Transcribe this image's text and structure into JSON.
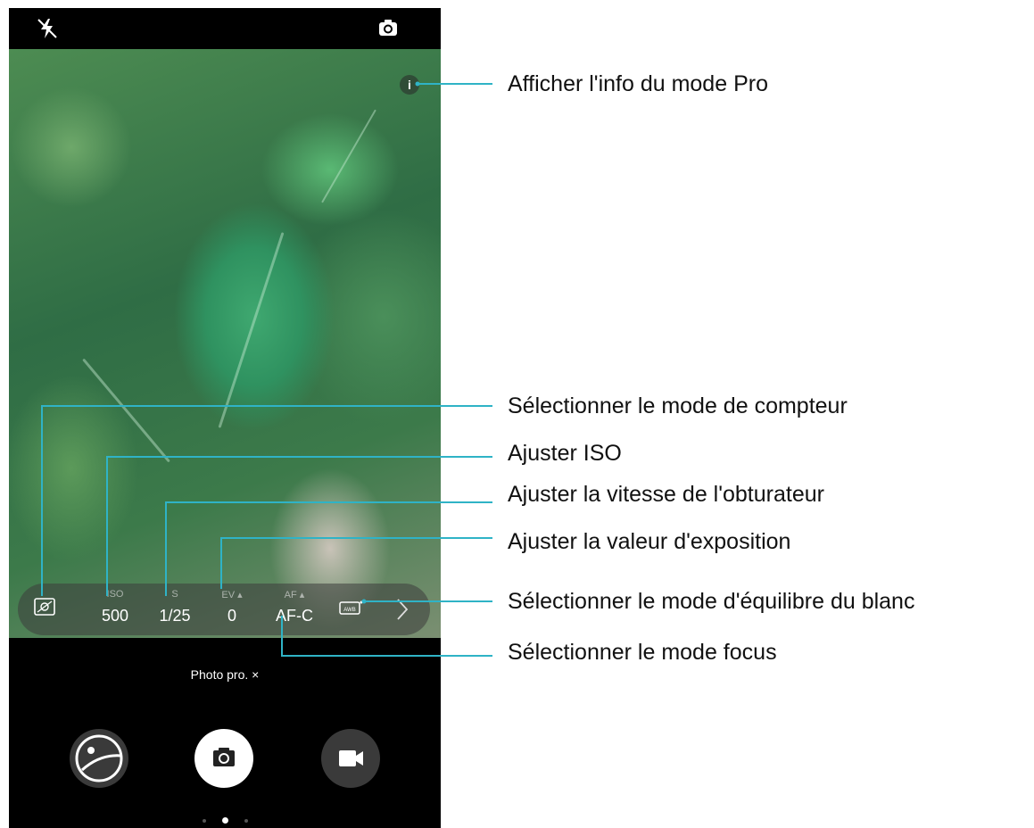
{
  "camera": {
    "mode_label": "Photo pro. ×",
    "info_icon_text": "i",
    "params": [
      {
        "name": "meter",
        "label": "",
        "value": "",
        "icon": "metering-icon"
      },
      {
        "name": "iso",
        "label": "ISO",
        "value": "500"
      },
      {
        "name": "shutter",
        "label": "S",
        "value": "1/25"
      },
      {
        "name": "ev",
        "label": "EV ▴",
        "value": "0"
      },
      {
        "name": "af",
        "label": "AF ▴",
        "value": "AF-C"
      },
      {
        "name": "awb",
        "label": "",
        "value": "",
        "icon": "awb-icon"
      }
    ],
    "top_icons": [
      "flash-off-icon",
      "switch-camera-icon"
    ],
    "bottom_icons": [
      "gallery-icon",
      "shutter-icon",
      "video-icon"
    ],
    "page_indicator": {
      "count": 3,
      "active": 2
    }
  },
  "callouts": {
    "info": "Afficher l'info du mode Pro",
    "meter": "Sélectionner le mode de compteur",
    "iso": "Ajuster ISO",
    "shutter": "Ajuster la vitesse de l'obturateur",
    "ev": "Ajuster la valeur d'exposition",
    "awb": "Sélectionner le mode d'équilibre du blanc",
    "af": "Sélectionner le mode focus"
  },
  "colors": {
    "callout_line": "#2fb3c6",
    "pro_bar": "#3c3c3c"
  }
}
